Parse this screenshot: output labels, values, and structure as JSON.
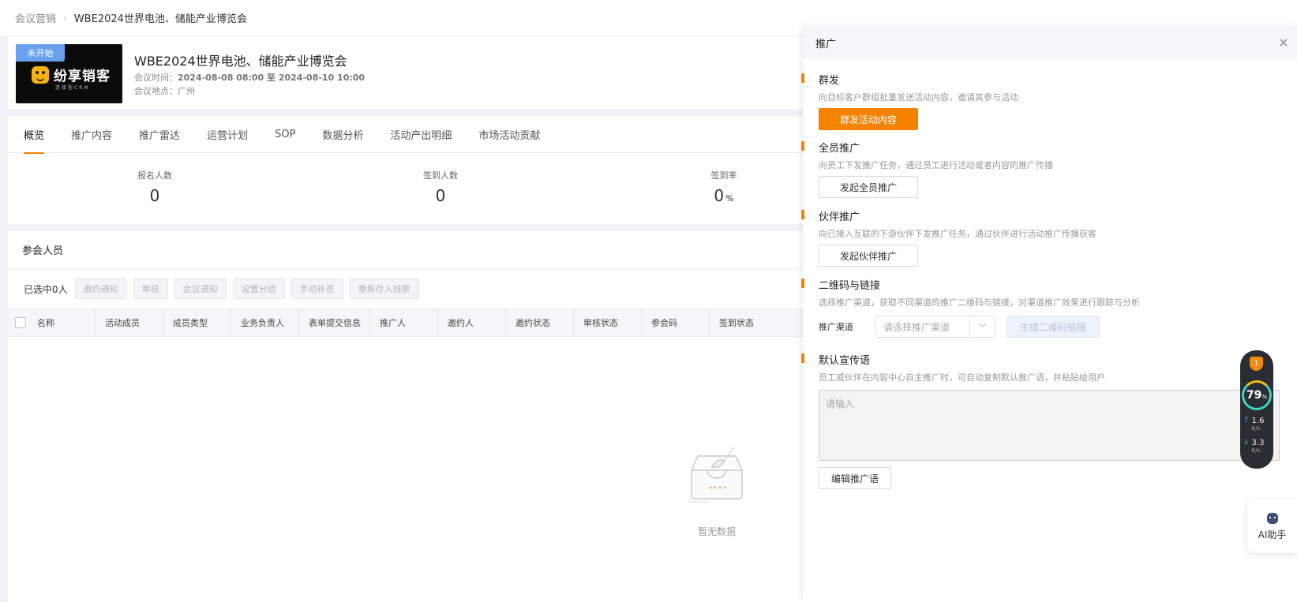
{
  "breadcrumb": {
    "parent": "会议营销",
    "separator": "›",
    "current": "WBE2024世界电池、储能产业博览会"
  },
  "event": {
    "status_badge": "未开始",
    "logo_text": "纷享销客",
    "logo_sub": "连接型CRM",
    "title": "WBE2024世界电池、储能产业博览会",
    "time_label": "会议时间：",
    "time_value": "2024-08-08 08:00 至 2024-08-10 10:00",
    "place_label": "会议地点：",
    "place_value": "广州"
  },
  "tabs": [
    "概览",
    "推广内容",
    "推广雷达",
    "运营计划",
    "SOP",
    "数据分析",
    "活动产出明细",
    "市场活动贡献"
  ],
  "active_tab": "概览",
  "stats": [
    {
      "label": "报名人数",
      "value": "0",
      "unit": ""
    },
    {
      "label": "签到人数",
      "value": "0",
      "unit": ""
    },
    {
      "label": "签到率",
      "value": "0",
      "unit": "%"
    }
  ],
  "members": {
    "title": "参会人员",
    "selected": "已选中0人",
    "toolbar": [
      "邀约通知",
      "审核",
      "会议通知",
      "设置分组",
      "手动补签",
      "重新存入线索"
    ],
    "columns": [
      "名称",
      "活动成员",
      "成员类型",
      "业务负责人",
      "表单提交信息",
      "推广人",
      "邀约人",
      "邀约状态",
      "审核状态",
      "参会码",
      "签到状态"
    ],
    "empty_text": "暂无数据"
  },
  "drawer": {
    "title": "推广",
    "close_icon": "close-icon",
    "sections": {
      "group_send": {
        "title": "群发",
        "desc": "向目标客户群组批量发送活动内容，邀请其参与活动",
        "button": "群发活动内容"
      },
      "staff": {
        "title": "全员推广",
        "desc": "向员工下发推广任务，通过员工进行活动或者内容的推广传播",
        "button": "发起全员推广"
      },
      "partner": {
        "title": "伙伴推广",
        "desc": "向已接入互联的下游伙伴下发推广任务，通过伙伴进行活动推广传播获客",
        "button": "发起伙伴推广"
      },
      "qrcode": {
        "title": "二维码与链接",
        "desc": "选择推广渠道，获取不同渠道的推广二维码与链接，对渠道推广效果进行跟踪与分析",
        "channel_label": "推广渠道",
        "channel_placeholder": "请选择推广渠道",
        "button": "生成二维码链接"
      },
      "slogan": {
        "title": "默认宣传语",
        "desc": "员工或伙伴在内容中心自主推广时，可自动复制默认推广语，并粘贴给用户",
        "placeholder": "请输入",
        "button": "编辑推广语"
      }
    }
  },
  "speed_widget": {
    "badge": "1",
    "percent": "79",
    "percent_unit": "%",
    "up_value": "1.6",
    "down_value": "3.3",
    "unit": "K/s"
  },
  "ai_helper": {
    "label": "AI助手"
  },
  "colors": {
    "accent": "#f58300",
    "badge": "#6aa0ee"
  }
}
